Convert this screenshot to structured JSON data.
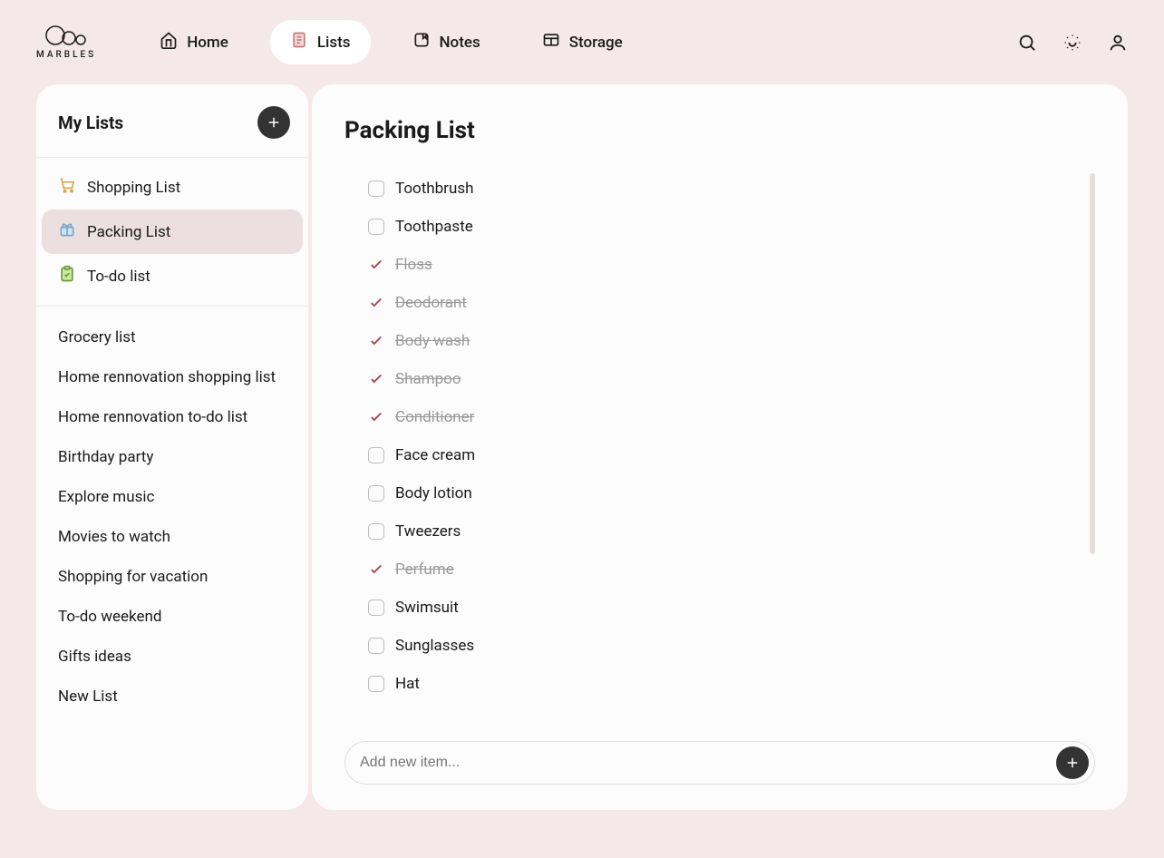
{
  "brand": {
    "name": "MARBLES"
  },
  "nav": {
    "tabs": [
      {
        "label": "Home",
        "active": false,
        "icon": "home"
      },
      {
        "label": "Lists",
        "active": true,
        "icon": "lists"
      },
      {
        "label": "Notes",
        "active": false,
        "icon": "notes"
      },
      {
        "label": "Storage",
        "active": false,
        "icon": "storage"
      }
    ]
  },
  "sidebar": {
    "title": "My Lists",
    "featured": [
      {
        "label": "Shopping List",
        "icon": "cart",
        "active": false
      },
      {
        "label": "Packing List",
        "icon": "gift",
        "active": true
      },
      {
        "label": "To-do list",
        "icon": "check",
        "active": false
      }
    ],
    "others": [
      {
        "label": "Grocery list"
      },
      {
        "label": "Home rennovation shopping list"
      },
      {
        "label": "Home rennovation to-do list"
      },
      {
        "label": "Birthday party"
      },
      {
        "label": "Explore music"
      },
      {
        "label": "Movies to watch"
      },
      {
        "label": "Shopping for vacation"
      },
      {
        "label": "To-do weekend"
      },
      {
        "label": "Gifts ideas"
      },
      {
        "label": "New List"
      }
    ]
  },
  "main": {
    "title": "Packing List",
    "items": [
      {
        "label": "Toothbrush",
        "done": false
      },
      {
        "label": "Toothpaste",
        "done": false
      },
      {
        "label": "Floss",
        "done": true
      },
      {
        "label": "Deodorant",
        "done": true
      },
      {
        "label": "Body wash",
        "done": true
      },
      {
        "label": "Shampoo",
        "done": true
      },
      {
        "label": "Conditioner",
        "done": true
      },
      {
        "label": "Face cream",
        "done": false
      },
      {
        "label": "Body lotion",
        "done": false
      },
      {
        "label": "Tweezers",
        "done": false
      },
      {
        "label": "Perfume",
        "done": true
      },
      {
        "label": "Swimsuit",
        "done": false
      },
      {
        "label": "Sunglasses",
        "done": false
      },
      {
        "label": "Hat",
        "done": false
      }
    ],
    "add_placeholder": "Add new item..."
  }
}
